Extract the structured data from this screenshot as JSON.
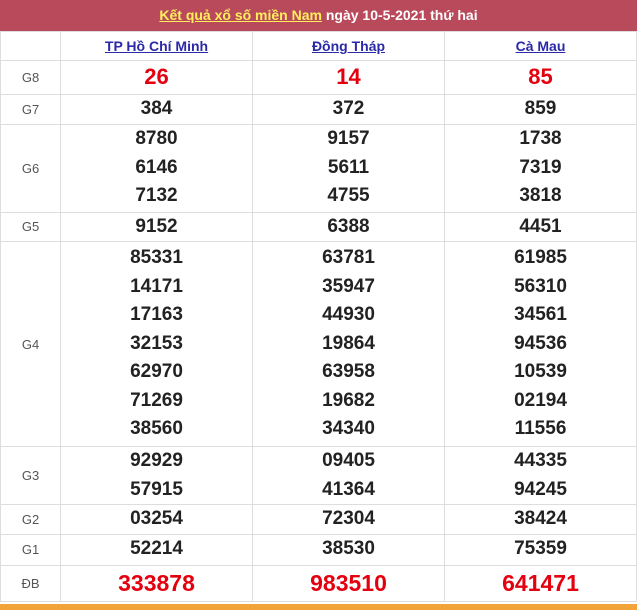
{
  "header": {
    "link_text": "Kết quả xổ số miền Nam",
    "date_text": "ngày 10-5-2021 thứ hai"
  },
  "provinces": [
    "TP Hồ Chí Minh",
    "Đồng Tháp",
    "Cà Mau"
  ],
  "prizes": [
    {
      "label": "G8",
      "rows": 1,
      "style": "red",
      "values": [
        [
          "26"
        ],
        [
          "14"
        ],
        [
          "85"
        ]
      ]
    },
    {
      "label": "G7",
      "rows": 1,
      "style": "normal",
      "values": [
        [
          "384"
        ],
        [
          "372"
        ],
        [
          "859"
        ]
      ]
    },
    {
      "label": "G6",
      "rows": 3,
      "style": "normal",
      "values": [
        [
          "8780",
          "6146",
          "7132"
        ],
        [
          "9157",
          "5611",
          "4755"
        ],
        [
          "1738",
          "7319",
          "3818"
        ]
      ]
    },
    {
      "label": "G5",
      "rows": 1,
      "style": "normal",
      "values": [
        [
          "9152"
        ],
        [
          "6388"
        ],
        [
          "4451"
        ]
      ]
    },
    {
      "label": "G4",
      "rows": 7,
      "style": "normal",
      "values": [
        [
          "85331",
          "14171",
          "17163",
          "32153",
          "62970",
          "71269",
          "38560"
        ],
        [
          "63781",
          "35947",
          "44930",
          "19864",
          "63958",
          "19682",
          "34340"
        ],
        [
          "61985",
          "56310",
          "34561",
          "94536",
          "10539",
          "02194",
          "11556"
        ]
      ]
    },
    {
      "label": "G3",
      "rows": 2,
      "style": "normal",
      "values": [
        [
          "92929",
          "57915"
        ],
        [
          "09405",
          "41364"
        ],
        [
          "44335",
          "94245"
        ]
      ]
    },
    {
      "label": "G2",
      "rows": 1,
      "style": "normal",
      "values": [
        [
          "03254"
        ],
        [
          "72304"
        ],
        [
          "38424"
        ]
      ]
    },
    {
      "label": "G1",
      "rows": 1,
      "style": "normal",
      "values": [
        [
          "52214"
        ],
        [
          "38530"
        ],
        [
          "75359"
        ]
      ]
    },
    {
      "label": "ĐB",
      "rows": 1,
      "style": "db",
      "values": [
        [
          "333878"
        ],
        [
          "983510"
        ],
        [
          "641471"
        ]
      ]
    }
  ]
}
